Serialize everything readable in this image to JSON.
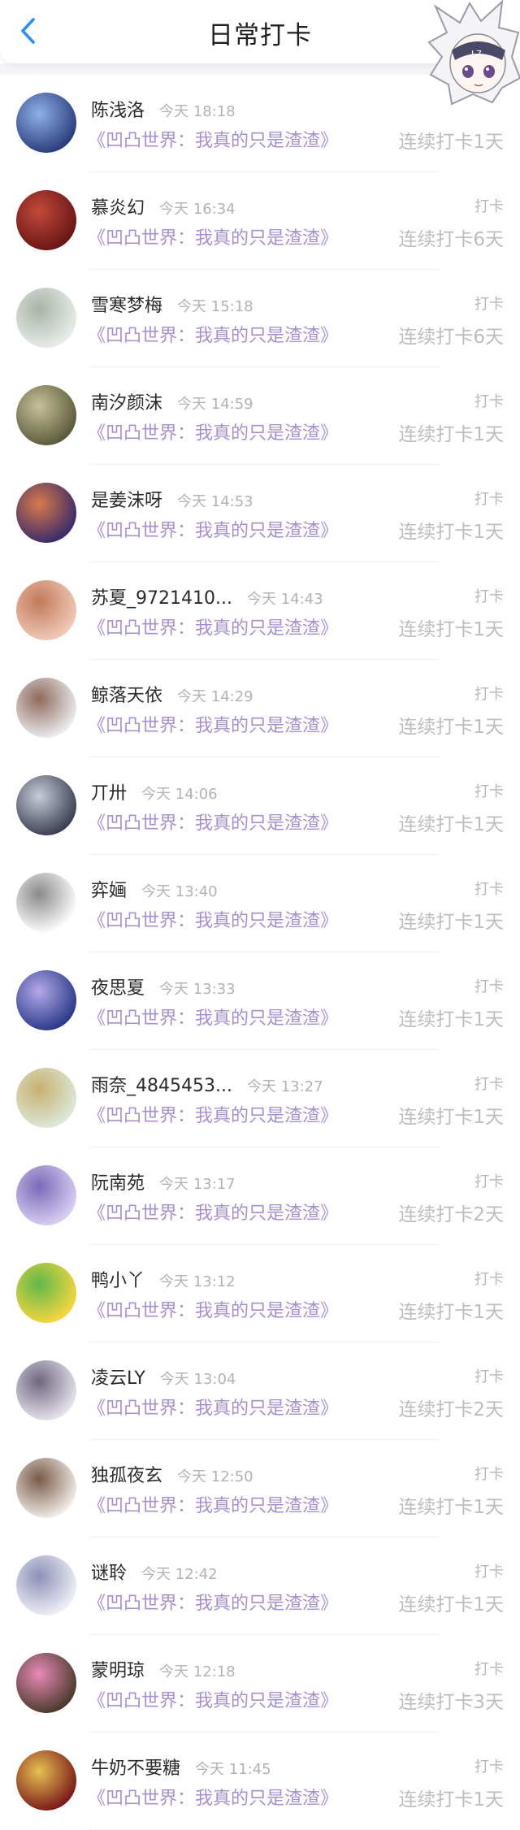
{
  "header": {
    "title": "日常打卡",
    "back_icon": "chevron-left-icon",
    "accent": "#2f8cf2"
  },
  "colors": {
    "book_title": "#a88fcf",
    "muted": "#b3b3b3"
  },
  "rows": [
    {
      "name": "陈浅洛",
      "time": "今天 18:18",
      "book": "《凹凸世界：我真的只是渣渣》",
      "checkin": "",
      "streak": "连续打卡1天",
      "avatar": [
        "#2a3d7a",
        "#8fb0e8"
      ]
    },
    {
      "name": "慕炎幻",
      "time": "今天 16:34",
      "book": "《凹凸世界：我真的只是渣渣》",
      "checkin": "打卡",
      "streak": "连续打卡6天",
      "avatar": [
        "#6a1515",
        "#c04a3a"
      ]
    },
    {
      "name": "雪寒梦梅",
      "time": "今天 15:18",
      "book": "《凹凸世界：我真的只是渣渣》",
      "checkin": "打卡",
      "streak": "连续打卡6天",
      "avatar": [
        "#e8ece8",
        "#a8b4a8"
      ]
    },
    {
      "name": "南汐颜沫",
      "time": "今天 14:59",
      "book": "《凹凸世界：我真的只是渣渣》",
      "checkin": "打卡",
      "streak": "连续打卡1天",
      "avatar": [
        "#5b5a3c",
        "#c7c19a"
      ]
    },
    {
      "name": "是姜沫呀",
      "time": "今天 14:53",
      "book": "《凹凸世界：我真的只是渣渣》",
      "checkin": "打卡",
      "streak": "连续打卡1天",
      "avatar": [
        "#3a2a6a",
        "#d87a4a"
      ]
    },
    {
      "name": "苏夏_9721410...",
      "time": "今天 14:43",
      "book": "《凹凸世界：我真的只是渣渣》",
      "checkin": "打卡",
      "streak": "连续打卡1天",
      "avatar": [
        "#f2c9b8",
        "#c07a5a"
      ]
    },
    {
      "name": "鲸落天依",
      "time": "今天 14:29",
      "book": "《凹凸世界：我真的只是渣渣》",
      "checkin": "打卡",
      "streak": "连续打卡1天",
      "avatar": [
        "#ececf0",
        "#8e6a5a"
      ]
    },
    {
      "name": "丌卅",
      "time": "今天 14:06",
      "book": "《凹凸世界：我真的只是渣渣》",
      "checkin": "打卡",
      "streak": "连续打卡1天",
      "avatar": [
        "#3a3f52",
        "#c8ccd8"
      ]
    },
    {
      "name": "弈婳",
      "time": "今天 13:40",
      "book": "《凹凸世界：我真的只是渣渣》",
      "checkin": "打卡",
      "streak": "连续打卡1天",
      "avatar": [
        "#ffffff",
        "#8a8a8a"
      ]
    },
    {
      "name": "夜思夏",
      "time": "今天 13:33",
      "book": "《凹凸世界：我真的只是渣渣》",
      "checkin": "打卡",
      "streak": "连续打卡1天",
      "avatar": [
        "#2a3a8a",
        "#b4a8e8"
      ]
    },
    {
      "name": "雨奈_4845453...",
      "time": "今天 13:27",
      "book": "《凹凸世界：我真的只是渣渣》",
      "checkin": "打卡",
      "streak": "连续打卡1天",
      "avatar": [
        "#dce8d8",
        "#c8b070"
      ]
    },
    {
      "name": "阮南苑",
      "time": "今天 13:17",
      "book": "《凹凸世界：我真的只是渣渣》",
      "checkin": "打卡",
      "streak": "连续打卡2天",
      "avatar": [
        "#d8cff2",
        "#7a6ab8"
      ]
    },
    {
      "name": "鸭小丫",
      "time": "今天 13:12",
      "book": "《凹凸世界：我真的只是渣渣》",
      "checkin": "打卡",
      "streak": "连续打卡1天",
      "avatar": [
        "#f7d640",
        "#5fb84a"
      ]
    },
    {
      "name": "凌云LY",
      "time": "今天 13:04",
      "book": "《凹凸世界：我真的只是渣渣》",
      "checkin": "打卡",
      "streak": "连续打卡2天",
      "avatar": [
        "#e6e3ec",
        "#6e6880"
      ]
    },
    {
      "name": "独孤夜玄",
      "time": "今天 12:50",
      "book": "《凹凸世界：我真的只是渣渣》",
      "checkin": "打卡",
      "streak": "连续打卡1天",
      "avatar": [
        "#f1ede8",
        "#7a5a48"
      ]
    },
    {
      "name": "谜聆",
      "time": "今天 12:42",
      "book": "《凹凸世界：我真的只是渣渣》",
      "checkin": "打卡",
      "streak": "连续打卡1天",
      "avatar": [
        "#eef0f6",
        "#8e90b8"
      ]
    },
    {
      "name": "蒙明琼",
      "time": "今天 12:18",
      "book": "《凹凸世界：我真的只是渣渣》",
      "checkin": "打卡",
      "streak": "连续打卡3天",
      "avatar": [
        "#4a3a2a",
        "#e88ab8"
      ]
    },
    {
      "name": "牛奶不要糖",
      "time": "今天 11:45",
      "book": "《凹凸世界：我真的只是渣渣》",
      "checkin": "打卡",
      "streak": "连续打卡1天",
      "avatar": [
        "#7a1a1a",
        "#e8c050"
      ]
    }
  ]
}
